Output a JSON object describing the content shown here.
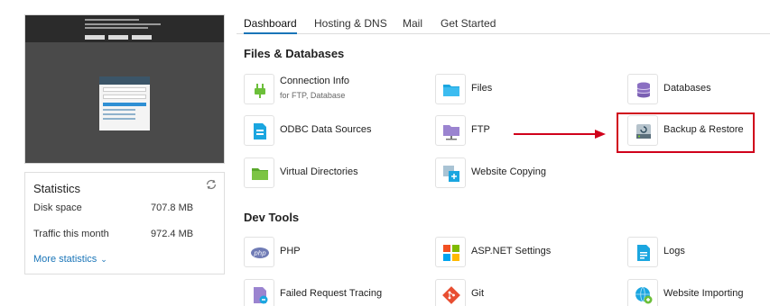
{
  "stats": {
    "title": "Statistics",
    "rows": [
      {
        "label": "Disk space",
        "value": "707.8 MB"
      },
      {
        "label": "Traffic this month",
        "value": "972.4 MB"
      }
    ],
    "more_label": "More statistics"
  },
  "tabs": [
    "Dashboard",
    "Hosting & DNS",
    "Mail",
    "Get Started"
  ],
  "sections": {
    "files": {
      "title": "Files & Databases",
      "items": [
        {
          "label": "Connection Info",
          "sub": "for FTP, Database",
          "icon": "connection-plug-icon"
        },
        {
          "label": "Files",
          "icon": "folder-blue-icon"
        },
        {
          "label": "Databases",
          "icon": "database-icon"
        },
        {
          "label": "ODBC Data Sources",
          "icon": "odbc-icon"
        },
        {
          "label": "FTP",
          "icon": "ftp-folder-icon"
        },
        {
          "label": "Backup & Restore",
          "icon": "backup-drive-icon"
        },
        {
          "label": "Virtual Directories",
          "icon": "folder-green-icon"
        },
        {
          "label": "Website Copying",
          "icon": "website-copy-icon"
        }
      ]
    },
    "dev": {
      "title": "Dev Tools",
      "items": [
        {
          "label": "PHP",
          "icon": "php-icon"
        },
        {
          "label": "ASP.NET Settings",
          "icon": "aspnet-icon"
        },
        {
          "label": "Logs",
          "icon": "logs-icon"
        },
        {
          "label": "Failed Request Tracing",
          "icon": "request-tracing-icon"
        },
        {
          "label": "Git",
          "icon": "git-icon"
        },
        {
          "label": "Website Importing",
          "icon": "website-import-icon"
        }
      ]
    }
  },
  "colors": {
    "accent": "#1a75b8",
    "highlight": "#d0021b"
  }
}
